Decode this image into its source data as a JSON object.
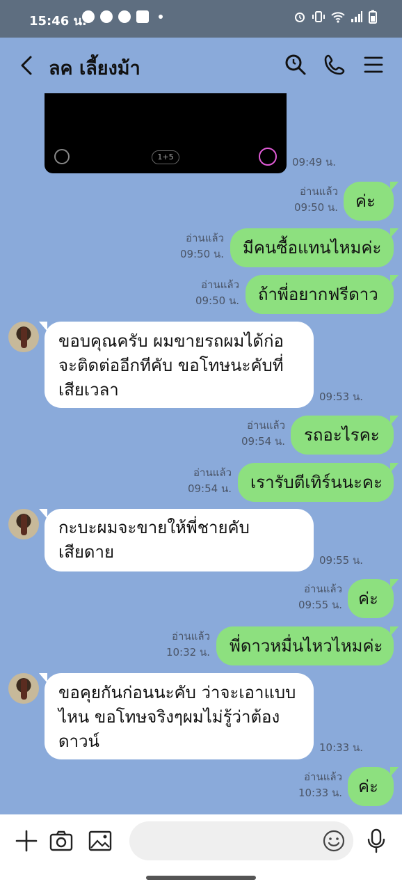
{
  "status": {
    "time": "15:46 น."
  },
  "header": {
    "title": "ลค เลี้ยงม้า"
  },
  "media": {
    "counter": "1+5",
    "time": "09:49 น."
  },
  "messages": [
    {
      "dir": "out",
      "text": "ค่ะ",
      "read": "อ่านแล้ว",
      "time": "09:50 น."
    },
    {
      "dir": "out",
      "text": "มีคนซื้อแทนไหมค่ะ",
      "read": "อ่านแล้ว",
      "time": "09:50 น."
    },
    {
      "dir": "out",
      "text": "ถ้าพี่อยากฟรีดาว",
      "read": "อ่านแล้ว",
      "time": "09:50 น."
    },
    {
      "dir": "in",
      "lines": [
        "ขอบคุณครับ ผมขายรถผมได้ก่อ",
        "จะติดต่ออีกทีคับ ขอโทษนะคับที่",
        "เสียเวลา"
      ],
      "time": "09:53 น."
    },
    {
      "dir": "out",
      "text": "รถอะไรคะ",
      "read": "อ่านแล้ว",
      "time": "09:54 น."
    },
    {
      "dir": "out",
      "text": "เรารับตีเทิร์นนะคะ",
      "read": "อ่านแล้ว",
      "time": "09:54 น."
    },
    {
      "dir": "in",
      "lines": [
        "กะบะผมจะขายให้พี่ชายคับ",
        "เสียดาย"
      ],
      "time": "09:55 น."
    },
    {
      "dir": "out",
      "text": "ค่ะ",
      "read": "อ่านแล้ว",
      "time": "09:55 น."
    },
    {
      "dir": "out",
      "text": "พี่ดาวหมื่นไหวไหมค่ะ",
      "read": "อ่านแล้ว",
      "time": "10:32 น."
    },
    {
      "dir": "in",
      "lines": [
        "ขอคุยกันก่อนนะคับ ว่าจะเอาแบบ",
        "ไหน ขอโทษจริงๆผมไม่รู้ว่าต้อง",
        "ดาวน์"
      ],
      "time": "10:33 น."
    },
    {
      "dir": "out",
      "text": "ค่ะ",
      "read": "อ่านแล้ว",
      "time": "10:33 น."
    }
  ],
  "input": {
    "placeholder": ""
  },
  "colors": {
    "chat_bg": "#8aaada",
    "outgoing_bubble": "#8de07f",
    "incoming_bubble": "#ffffff"
  }
}
